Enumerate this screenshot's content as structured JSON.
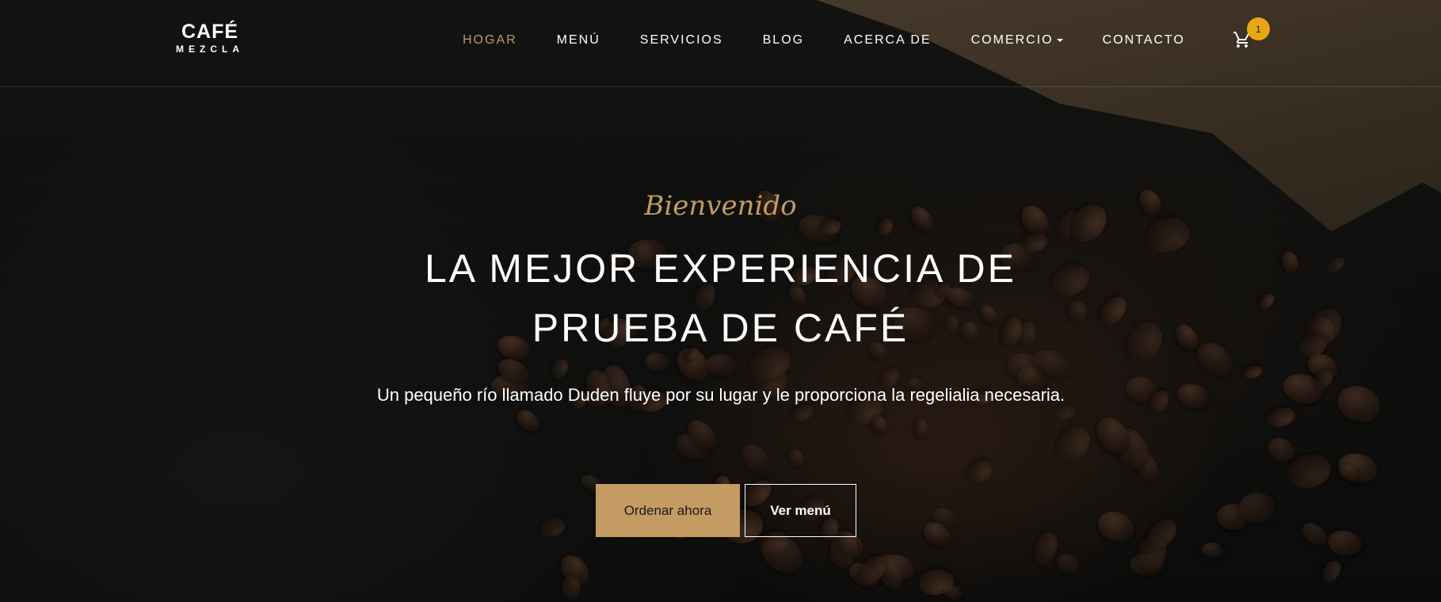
{
  "brand": {
    "top": "CAFÉ",
    "bottom": "MEZCLA"
  },
  "nav": {
    "items": [
      {
        "label": "HOGAR",
        "active": true
      },
      {
        "label": "MENÚ"
      },
      {
        "label": "SERVICIOS"
      },
      {
        "label": "BLOG"
      },
      {
        "label": "ACERCA DE"
      },
      {
        "label": "COMERCIO",
        "dropdown": true
      },
      {
        "label": "CONTACTO"
      }
    ],
    "cart_icon": "cart-icon",
    "cart_count": "1"
  },
  "hero": {
    "welcome": "Bienvenido",
    "headline_line1": "LA MEJOR EXPERIENCIA DE",
    "headline_line2": "PRUEBA DE CAFÉ",
    "subtitle": "Un pequeño río llamado Duden fluye por su lugar y le proporciona la regelialia necesaria.",
    "primary_button": "Ordenar ahora",
    "secondary_button": "Ver menú"
  },
  "colors": {
    "accent": "#c49b63",
    "badge": "#e8a813"
  }
}
